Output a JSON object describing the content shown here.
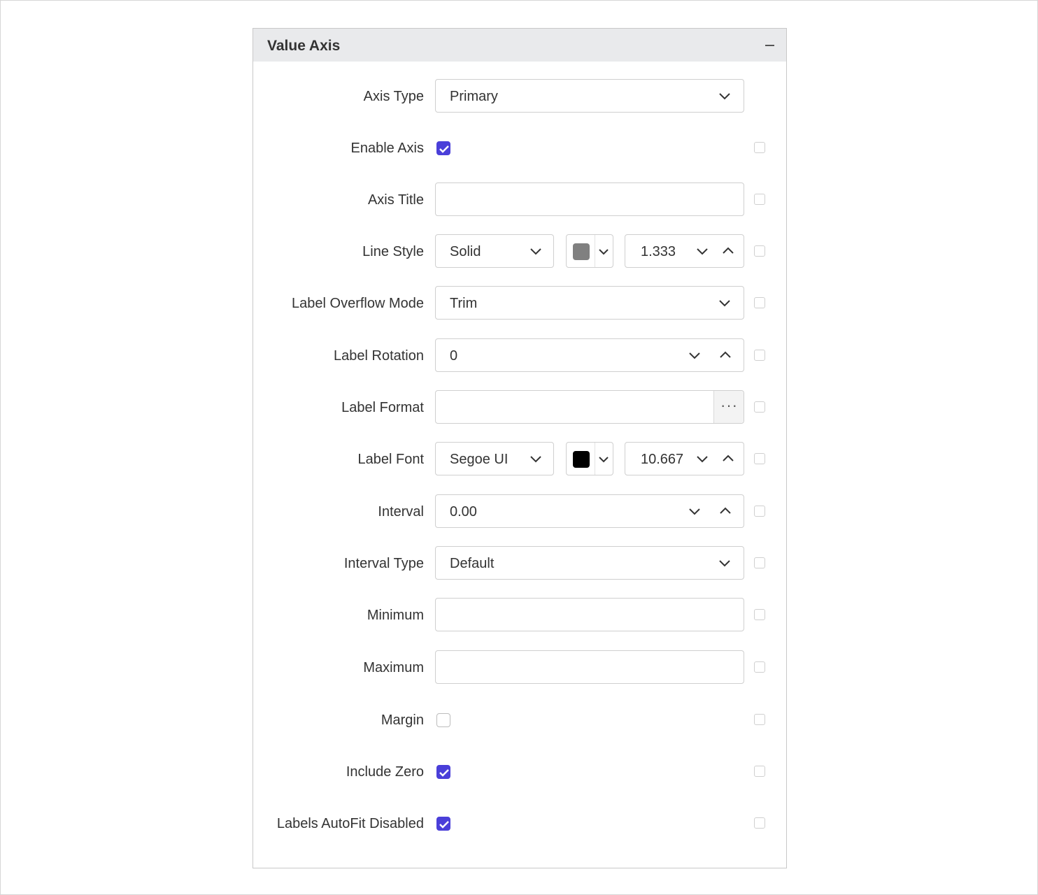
{
  "panel": {
    "title": "Value Axis",
    "collapse_icon": "minus-icon"
  },
  "colors": {
    "accent": "#4a3fd9",
    "line_color": "#808080",
    "font_color": "#000000"
  },
  "fields": {
    "axis_type": {
      "label": "Axis Type",
      "value": "Primary"
    },
    "enable_axis": {
      "label": "Enable Axis",
      "checked": true
    },
    "axis_title": {
      "label": "Axis Title",
      "value": ""
    },
    "line_style": {
      "label": "Line Style",
      "style": "Solid",
      "width": "1.333"
    },
    "label_overflow_mode": {
      "label": "Label Overflow Mode",
      "value": "Trim"
    },
    "label_rotation": {
      "label": "Label Rotation",
      "value": "0"
    },
    "label_format": {
      "label": "Label Format",
      "value": "",
      "button": "···"
    },
    "label_font": {
      "label": "Label Font",
      "family": "Segoe UI",
      "size": "10.667"
    },
    "interval": {
      "label": "Interval",
      "value": "0.00"
    },
    "interval_type": {
      "label": "Interval Type",
      "value": "Default"
    },
    "minimum": {
      "label": "Minimum",
      "value": ""
    },
    "maximum": {
      "label": "Maximum",
      "value": ""
    },
    "margin": {
      "label": "Margin",
      "checked": false
    },
    "include_zero": {
      "label": "Include Zero",
      "checked": true
    },
    "labels_autofit_disabled": {
      "label": "Labels AutoFit Disabled",
      "checked": true
    }
  }
}
